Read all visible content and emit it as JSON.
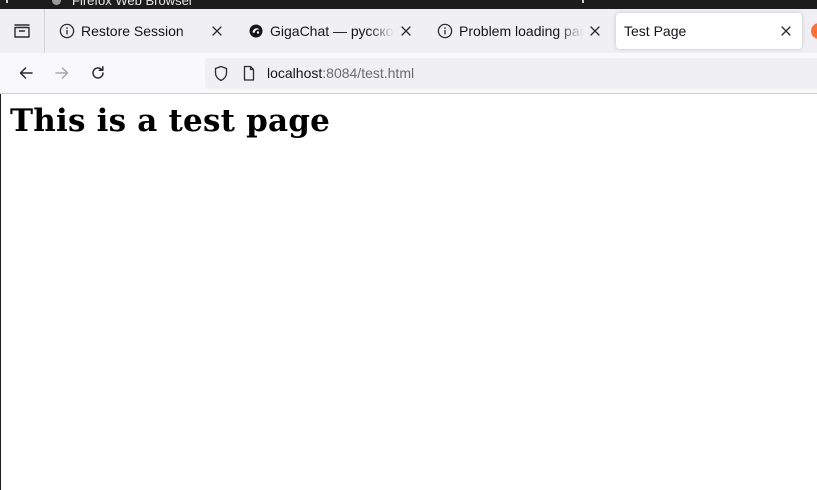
{
  "os_bar": {
    "title": "Firefox Web Browser"
  },
  "tabs": [
    {
      "label": "Restore Session",
      "icon": "info-icon",
      "active": false
    },
    {
      "label": "GigaChat — русскоязычная нейросеть",
      "icon": "gigachat-favicon",
      "active": false
    },
    {
      "label": "Problem loading page",
      "icon": "info-icon",
      "active": false
    },
    {
      "label": "Test Page",
      "icon": "none",
      "active": true
    }
  ],
  "url": {
    "host": "localhost",
    "rest": ":8084/test.html"
  },
  "page": {
    "heading": "This is a test page"
  },
  "colors": {
    "tabbar_bg": "#f0f0f4",
    "toolbar_bg": "#f9f9fb",
    "url_dim": "#6b6b73",
    "text": "#15141a",
    "brand_orange": "#ff7139"
  }
}
